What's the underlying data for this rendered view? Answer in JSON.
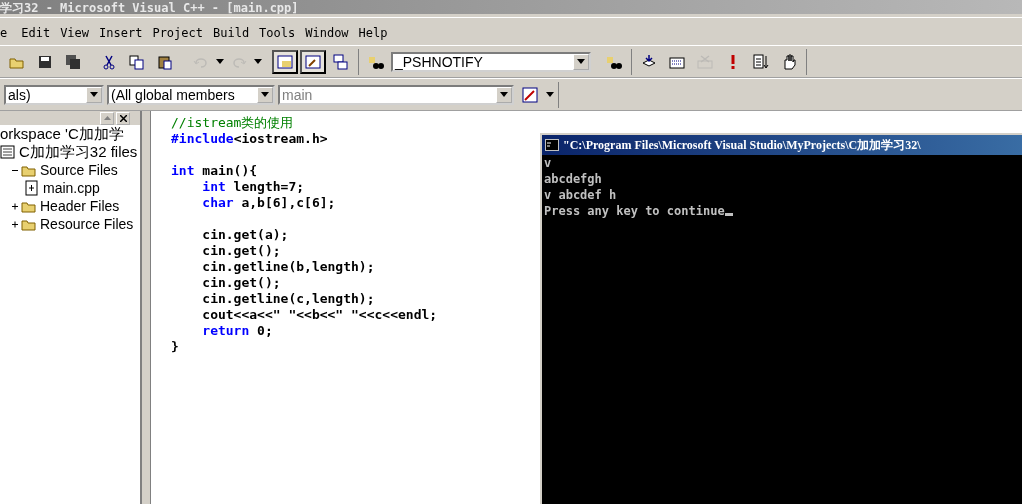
{
  "window": {
    "title": "学习32 - Microsoft Visual C++ - [main.cpp]"
  },
  "menu": [
    "e",
    "Edit",
    "View",
    "Insert",
    "Project",
    "Build",
    "Tools",
    "Window",
    "Help"
  ],
  "standard_toolbar": {
    "buttons": [
      {
        "pressed": false,
        "disabled": false
      },
      {
        "pressed": false,
        "disabled": false
      },
      {
        "pressed": false,
        "disabled": false
      },
      {
        "pressed": false,
        "disabled": false
      },
      {
        "pressed": false,
        "disabled": false
      },
      {
        "pressed": false,
        "disabled": false
      },
      {
        "pressed": false,
        "disabled": true
      },
      {
        "pressed": false,
        "disabled": true
      },
      {
        "pressed": true,
        "disabled": false
      },
      {
        "pressed": true,
        "disabled": false
      },
      {
        "pressed": false,
        "disabled": false
      }
    ],
    "find_combo": "_PSHNOTIFY"
  },
  "build_toolbar": {
    "buttons": [
      {
        "disabled": false
      },
      {
        "disabled": false
      },
      {
        "disabled": true
      },
      {
        "disabled": false
      },
      {
        "disabled": false
      },
      {
        "disabled": false
      }
    ]
  },
  "wizard_bar": {
    "class_combo": "als)",
    "filter_combo": "(All global members",
    "members_combo": "main"
  },
  "workspace": {
    "tree": [
      {
        "label": "orkspace 'C加加学",
        "kind": "workspace",
        "children": [
          {
            "label": "C加加学习32 files",
            "kind": "project",
            "children": [
              {
                "label": "Source Files",
                "kind": "folder",
                "expanded": true,
                "children": [
                  {
                    "label": "main.cpp",
                    "kind": "file"
                  }
                ]
              },
              {
                "label": "Header Files",
                "kind": "folder",
                "expanded": false
              },
              {
                "label": "Resource Files",
                "kind": "folder",
                "expanded": false
              }
            ]
          }
        ]
      }
    ]
  },
  "editor": {
    "blocks": [
      [
        [
          {
            "kind": "comment",
            "text": "//istream类的使用"
          }
        ],
        [
          {
            "kind": "keyword",
            "text": "#include"
          },
          {
            "kind": "plain",
            "text": "<iostream.h>"
          }
        ]
      ],
      [
        [
          {
            "kind": "keyword",
            "text": "int"
          },
          {
            "kind": "plain",
            "text": " main(){"
          }
        ],
        [
          {
            "kind": "keyword",
            "text": "    int"
          },
          {
            "kind": "plain",
            "text": " length=7;"
          }
        ],
        [
          {
            "kind": "keyword",
            "text": "    char"
          },
          {
            "kind": "plain",
            "text": " a,b[6],c[6];"
          }
        ]
      ],
      [
        [
          {
            "kind": "plain",
            "text": "    cin.get(a);"
          }
        ],
        [
          {
            "kind": "plain",
            "text": "    cin.get();"
          }
        ],
        [
          {
            "kind": "plain",
            "text": "    cin.getline(b,length);"
          }
        ],
        [
          {
            "kind": "plain",
            "text": "    cin.get();"
          }
        ],
        [
          {
            "kind": "plain",
            "text": "    cin.getline(c,length);"
          }
        ],
        [
          {
            "kind": "plain",
            "text": "    cout<<a<<\" \"<<b<<\" \"<<c<<endl;"
          }
        ],
        [
          {
            "kind": "keyword",
            "text": "    return"
          },
          {
            "kind": "plain",
            "text": " 0;"
          }
        ],
        [
          {
            "kind": "plain",
            "text": "}"
          }
        ]
      ]
    ]
  },
  "console": {
    "title": "\"C:\\Program Files\\Microsoft Visual Studio\\MyProjects\\C加加学习32\\",
    "lines": [
      "v",
      "abcdefgh",
      "v abcdef h",
      "Press any key to continue"
    ],
    "cursor": true
  }
}
